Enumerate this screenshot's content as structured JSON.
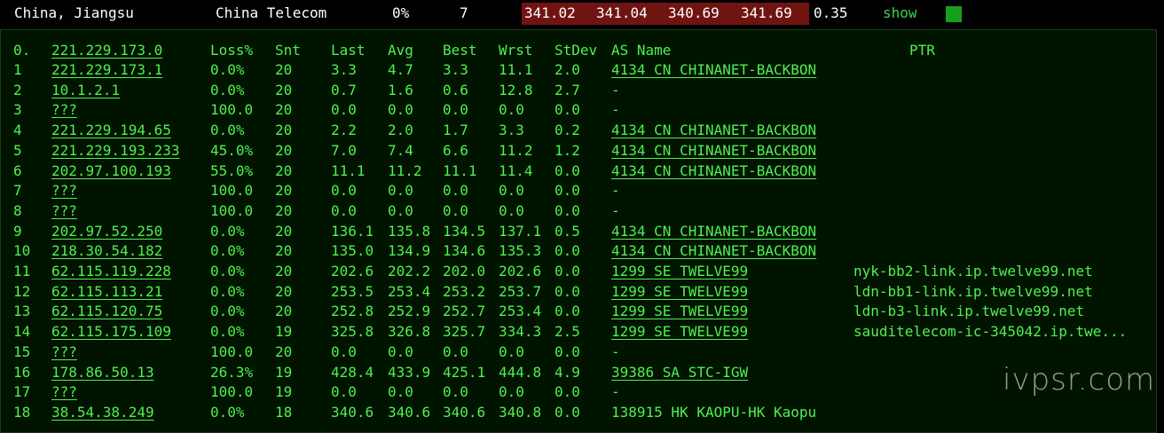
{
  "summary": {
    "location": "China, Jiangsu",
    "isp": "China Telecom",
    "loss": "0%",
    "hops": "7",
    "latencies": [
      "341.02",
      "341.04",
      "340.69",
      "341.69"
    ],
    "stdev": "0.35",
    "show_label": "show",
    "status_color": "#14a01e"
  },
  "table": {
    "header": {
      "hop": "0.",
      "host": "221.229.173.0",
      "loss": "Loss%",
      "snt": "Snt",
      "last": "Last",
      "avg": "Avg",
      "best": "Best",
      "wrst": "Wrst",
      "stdev": "StDev",
      "as": "AS Name",
      "ptr": "PTR"
    },
    "rows": [
      {
        "hop": "1",
        "host": "221.229.173.1",
        "loss": "0.0%",
        "snt": "20",
        "last": "3.3",
        "avg": "4.7",
        "best": "3.3",
        "wrst": "11.1",
        "stdev": "2.0",
        "as": "4134  CN CHINANET-BACKBON",
        "ptr": ""
      },
      {
        "hop": "2",
        "host": "10.1.2.1",
        "loss": "0.0%",
        "snt": "20",
        "last": "0.7",
        "avg": "1.6",
        "best": "0.6",
        "wrst": "12.8",
        "stdev": "2.7",
        "as": "-",
        "ptr": ""
      },
      {
        "hop": "3",
        "host": "???",
        "loss": "100.0",
        "snt": "20",
        "last": "0.0",
        "avg": "0.0",
        "best": "0.0",
        "wrst": "0.0",
        "stdev": "0.0",
        "as": "-",
        "ptr": ""
      },
      {
        "hop": "4",
        "host": "221.229.194.65",
        "loss": "0.0%",
        "snt": "20",
        "last": "2.2",
        "avg": "2.0",
        "best": "1.7",
        "wrst": "3.3",
        "stdev": "0.2",
        "as": "4134  CN CHINANET-BACKBON",
        "ptr": ""
      },
      {
        "hop": "5",
        "host": "221.229.193.233",
        "loss": "45.0%",
        "snt": "20",
        "last": "7.0",
        "avg": "7.4",
        "best": "6.6",
        "wrst": "11.2",
        "stdev": "1.2",
        "as": "4134  CN CHINANET-BACKBON",
        "ptr": ""
      },
      {
        "hop": "6",
        "host": "202.97.100.193",
        "loss": "55.0%",
        "snt": "20",
        "last": "11.1",
        "avg": "11.2",
        "best": "11.1",
        "wrst": "11.4",
        "stdev": "0.0",
        "as": "4134  CN CHINANET-BACKBON",
        "ptr": ""
      },
      {
        "hop": "7",
        "host": "???",
        "loss": "100.0",
        "snt": "20",
        "last": "0.0",
        "avg": "0.0",
        "best": "0.0",
        "wrst": "0.0",
        "stdev": "0.0",
        "as": "-",
        "ptr": ""
      },
      {
        "hop": "8",
        "host": "???",
        "loss": "100.0",
        "snt": "20",
        "last": "0.0",
        "avg": "0.0",
        "best": "0.0",
        "wrst": "0.0",
        "stdev": "0.0",
        "as": "-",
        "ptr": ""
      },
      {
        "hop": "9",
        "host": "202.97.52.250",
        "loss": "0.0%",
        "snt": "20",
        "last": "136.1",
        "avg": "135.8",
        "best": "134.5",
        "wrst": "137.1",
        "stdev": "0.5",
        "as": "4134  CN CHINANET-BACKBON",
        "ptr": ""
      },
      {
        "hop": "10",
        "host": "218.30.54.182",
        "loss": "0.0%",
        "snt": "20",
        "last": "135.0",
        "avg": "134.9",
        "best": "134.6",
        "wrst": "135.3",
        "stdev": "0.0",
        "as": "4134  CN CHINANET-BACKBON",
        "ptr": ""
      },
      {
        "hop": "11",
        "host": "62.115.119.228",
        "loss": "0.0%",
        "snt": "20",
        "last": "202.6",
        "avg": "202.2",
        "best": "202.0",
        "wrst": "202.6",
        "stdev": "0.0",
        "as": "1299  SE TWELVE99",
        "ptr": "nyk-bb2-link.ip.twelve99.net"
      },
      {
        "hop": "12",
        "host": "62.115.113.21",
        "loss": "0.0%",
        "snt": "20",
        "last": "253.5",
        "avg": "253.4",
        "best": "253.2",
        "wrst": "253.7",
        "stdev": "0.0",
        "as": "1299  SE TWELVE99",
        "ptr": "ldn-bb1-link.ip.twelve99.net"
      },
      {
        "hop": "13",
        "host": "62.115.120.75",
        "loss": "0.0%",
        "snt": "20",
        "last": "252.8",
        "avg": "252.9",
        "best": "252.7",
        "wrst": "253.4",
        "stdev": "0.0",
        "as": "1299  SE TWELVE99",
        "ptr": "ldn-b3-link.ip.twelve99.net"
      },
      {
        "hop": "14",
        "host": "62.115.175.109",
        "loss": "0.0%",
        "snt": "19",
        "last": "325.8",
        "avg": "326.8",
        "best": "325.7",
        "wrst": "334.3",
        "stdev": "2.5",
        "as": "1299  SE TWELVE99",
        "ptr": "sauditelecom-ic-345042.ip.twe..."
      },
      {
        "hop": "15",
        "host": "???",
        "loss": "100.0",
        "snt": "20",
        "last": "0.0",
        "avg": "0.0",
        "best": "0.0",
        "wrst": "0.0",
        "stdev": "0.0",
        "as": "-",
        "ptr": ""
      },
      {
        "hop": "16",
        "host": "178.86.50.13",
        "loss": "26.3%",
        "snt": "19",
        "last": "428.4",
        "avg": "433.9",
        "best": "425.1",
        "wrst": "444.8",
        "stdev": "4.9",
        "as": "39386 SA STC-IGW",
        "ptr": ""
      },
      {
        "hop": "17",
        "host": "???",
        "loss": "100.0",
        "snt": "19",
        "last": "0.0",
        "avg": "0.0",
        "best": "0.0",
        "wrst": "0.0",
        "stdev": "0.0",
        "as": "-",
        "ptr": ""
      },
      {
        "hop": "18",
        "host": "38.54.38.249",
        "loss": "0.0%",
        "snt": "18",
        "last": "340.6",
        "avg": "340.6",
        "best": "340.6",
        "wrst": "340.8",
        "stdev": "0.0",
        "as": "138915 HK KAOPU-HK Kaopu",
        "ptr": ""
      }
    ]
  },
  "watermark": "ivpsr.com"
}
